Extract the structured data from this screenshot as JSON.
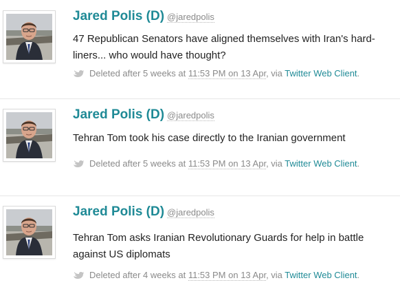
{
  "colors": {
    "name": "#1f8a96",
    "text": "#222222",
    "muted": "#8a8a8a",
    "link": "#1f8a96",
    "divider": "#e6e6e6"
  },
  "tweets": [
    {
      "name": "Jared Polis (D)",
      "handle": "@jaredpolis",
      "text": "47 Republican Senators have aligned themselves with Iran's hard-liners... who would have thought?",
      "deleted_prefix": "Deleted after 5 weeks at",
      "time": "11:53 PM on 13 Apr",
      "via": ", via",
      "client": "Twitter Web Client",
      "end": ".",
      "bird_icon": "twitter-bird-icon"
    },
    {
      "name": "Jared Polis (D)",
      "handle": "@jaredpolis",
      "text": "Tehran Tom took his case directly to the Iranian government",
      "deleted_prefix": "Deleted after 5 weeks at",
      "time": "11:53 PM on 13 Apr",
      "via": ", via",
      "client": "Twitter Web Client",
      "end": ".",
      "bird_icon": "twitter-bird-icon"
    },
    {
      "name": "Jared Polis (D)",
      "handle": "@jaredpolis",
      "text": "Tehran Tom asks Iranian Revolutionary Guards for help in battle against US diplomats",
      "deleted_prefix": "Deleted after 4 weeks at",
      "time": "11:53 PM on 13 Apr",
      "via": ", via",
      "client": "Twitter Web Client",
      "end": ".",
      "bird_icon": "twitter-bird-icon"
    }
  ]
}
